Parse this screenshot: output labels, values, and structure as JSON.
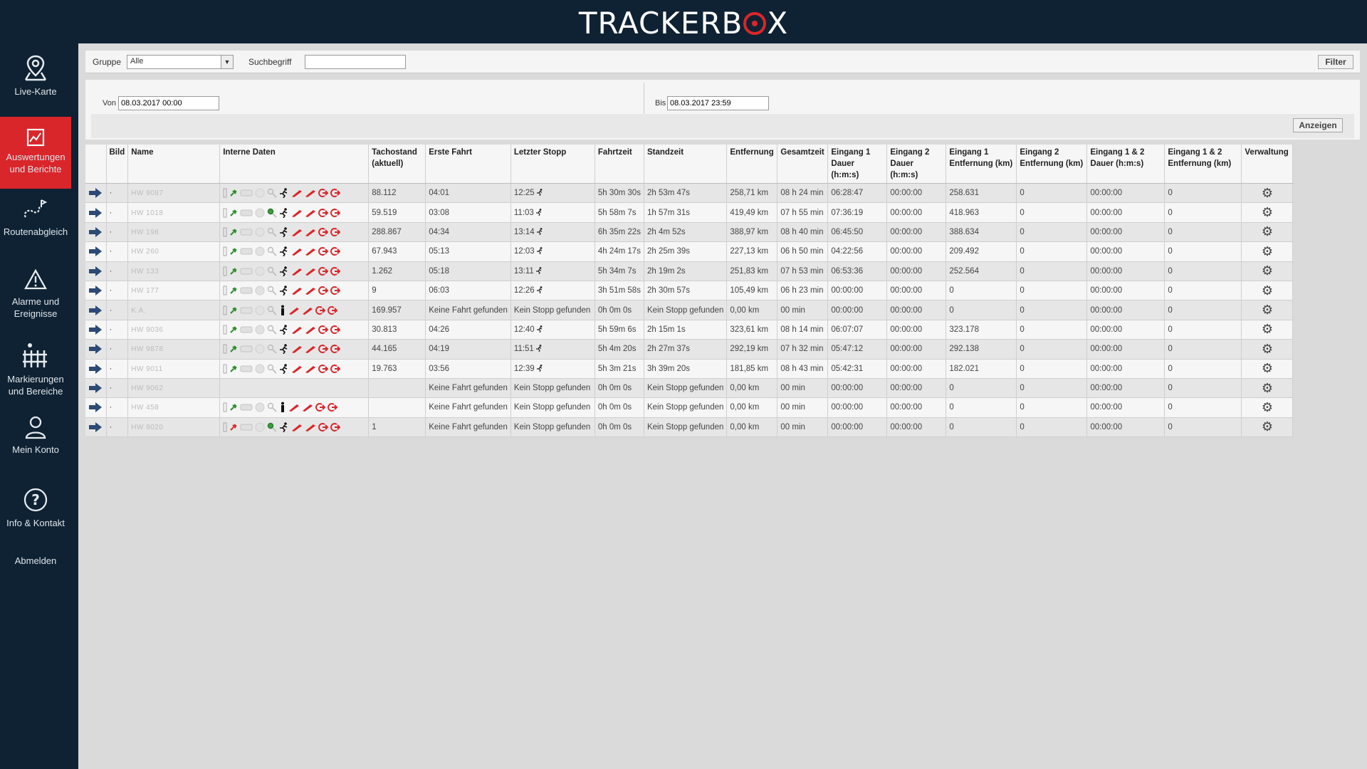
{
  "app": {
    "logo_text": "TRACKERB",
    "logo_end": "X"
  },
  "sidebar": {
    "items": [
      {
        "label": "Live-Karte",
        "icon": "map-pin-icon",
        "active": false
      },
      {
        "label": "Auswertungen und Berichte",
        "icon": "chart-icon",
        "active": true
      },
      {
        "label": "Routenabgleich",
        "icon": "route-icon",
        "active": false
      },
      {
        "label": "Alarme und Ereignisse",
        "icon": "warning-icon",
        "active": false
      },
      {
        "label": "Markierungen und Bereiche",
        "icon": "fence-icon",
        "active": false
      },
      {
        "label": "Mein Konto",
        "icon": "user-icon",
        "active": false
      },
      {
        "label": "Info & Kontakt",
        "icon": "question-icon",
        "active": false
      },
      {
        "label": "Abmelden",
        "icon": "",
        "active": false
      }
    ]
  },
  "filter": {
    "group_label": "Gruppe",
    "group_value": "Alle",
    "search_label": "Suchbegriff",
    "search_value": "",
    "filter_button": "Filter"
  },
  "dates": {
    "from_label": "Von",
    "from_value": "08.03.2017 00:00",
    "to_label": "Bis",
    "to_value": "08.03.2017 23:59",
    "show_button": "Anzeigen"
  },
  "table": {
    "headers": [
      "",
      "Bild",
      "Name",
      "Interne Daten",
      "Tachostand (aktuell)",
      "Erste Fahrt",
      "Letzter Stopp",
      "Fahrtzeit",
      "Standzeit",
      "Entfernung",
      "Gesamtzeit",
      "Eingang 1 Dauer (h:m:s)",
      "Eingang 2 Dauer (h:m:s)",
      "Eingang 1 Entfernung (km)",
      "Eingang 2 Entfernung (km)",
      "Eingang 1 & 2 Dauer (h:m:s)",
      "Eingang 1 & 2 Entfernung (km)",
      "Verwaltung"
    ],
    "rows": [
      {
        "bild": "·",
        "name": "HW 9087",
        "person": false,
        "green_search": false,
        "red_plug": false,
        "tacho": "88.112",
        "erste": "04:01",
        "letzter": "12:25",
        "stop_icon": true,
        "fahrt": "5h 30m 30s",
        "stand": "2h 53m 47s",
        "entf": "258,71 km",
        "gesamt": "08 h 24 min",
        "e1d": "06:28:47",
        "e2d": "00:00:00",
        "e1e": "258.631",
        "e2e": "0",
        "e12d": "00:00:00",
        "e12e": "0"
      },
      {
        "bild": "·",
        "name": "HW 1018",
        "person": false,
        "green_search": true,
        "red_plug": false,
        "tacho": "59.519",
        "erste": "03:08",
        "letzter": "11:03",
        "stop_icon": true,
        "fahrt": "5h 58m 7s",
        "stand": "1h 57m 31s",
        "entf": "419,49 km",
        "gesamt": "07 h 55 min",
        "e1d": "07:36:19",
        "e2d": "00:00:00",
        "e1e": "418.963",
        "e2e": "0",
        "e12d": "00:00:00",
        "e12e": "0"
      },
      {
        "bild": "·",
        "name": "HW 198",
        "person": false,
        "green_search": false,
        "red_plug": false,
        "tacho": "288.867",
        "erste": "04:34",
        "letzter": "13:14",
        "stop_icon": true,
        "fahrt": "6h 35m 22s",
        "stand": "2h 4m 52s",
        "entf": "388,97 km",
        "gesamt": "08 h 40 min",
        "e1d": "06:45:50",
        "e2d": "00:00:00",
        "e1e": "388.634",
        "e2e": "0",
        "e12d": "00:00:00",
        "e12e": "0"
      },
      {
        "bild": "·",
        "name": "HW 260",
        "person": false,
        "green_search": false,
        "red_plug": false,
        "tacho": "67.943",
        "erste": "05:13",
        "letzter": "12:03",
        "stop_icon": true,
        "fahrt": "4h 24m 17s",
        "stand": "2h 25m 39s",
        "entf": "227,13 km",
        "gesamt": "06 h 50 min",
        "e1d": "04:22:56",
        "e2d": "00:00:00",
        "e1e": "209.492",
        "e2e": "0",
        "e12d": "00:00:00",
        "e12e": "0"
      },
      {
        "bild": "·",
        "name": "HW 133",
        "person": false,
        "green_search": false,
        "red_plug": false,
        "tacho": "1.262",
        "erste": "05:18",
        "letzter": "13:11",
        "stop_icon": true,
        "fahrt": "5h 34m 7s",
        "stand": "2h 19m 2s",
        "entf": "251,83 km",
        "gesamt": "07 h 53 min",
        "e1d": "06:53:36",
        "e2d": "00:00:00",
        "e1e": "252.564",
        "e2e": "0",
        "e12d": "00:00:00",
        "e12e": "0"
      },
      {
        "bild": "·",
        "name": "HW 177",
        "person": false,
        "green_search": false,
        "red_plug": false,
        "tacho": "9",
        "erste": "06:03",
        "letzter": "12:26",
        "stop_icon": true,
        "fahrt": "3h 51m 58s",
        "stand": "2h 30m 57s",
        "entf": "105,49 km",
        "gesamt": "06 h 23 min",
        "e1d": "00:00:00",
        "e2d": "00:00:00",
        "e1e": "0",
        "e2e": "0",
        "e12d": "00:00:00",
        "e12e": "0"
      },
      {
        "bild": "·",
        "name": "K.A.",
        "person": true,
        "green_search": false,
        "red_plug": false,
        "tacho": "169.957",
        "erste": "Keine Fahrt gefunden",
        "letzter": "Kein Stopp gefunden",
        "stop_icon": false,
        "fahrt": "0h 0m 0s",
        "stand": "Kein Stopp gefunden",
        "entf": "0,00 km",
        "gesamt": "00 min",
        "e1d": "00:00:00",
        "e2d": "00:00:00",
        "e1e": "0",
        "e2e": "0",
        "e12d": "00:00:00",
        "e12e": "0"
      },
      {
        "bild": "·",
        "name": "HW 9036",
        "person": false,
        "green_search": false,
        "red_plug": false,
        "tacho": "30.813",
        "erste": "04:26",
        "letzter": "12:40",
        "stop_icon": true,
        "fahrt": "5h 59m 6s",
        "stand": "2h 15m 1s",
        "entf": "323,61 km",
        "gesamt": "08 h 14 min",
        "e1d": "06:07:07",
        "e2d": "00:00:00",
        "e1e": "323.178",
        "e2e": "0",
        "e12d": "00:00:00",
        "e12e": "0"
      },
      {
        "bild": "·",
        "name": "HW 9878",
        "person": false,
        "green_search": false,
        "red_plug": false,
        "tacho": "44.165",
        "erste": "04:19",
        "letzter": "11:51",
        "stop_icon": true,
        "fahrt": "5h 4m 20s",
        "stand": "2h 27m 37s",
        "entf": "292,19 km",
        "gesamt": "07 h 32 min",
        "e1d": "05:47:12",
        "e2d": "00:00:00",
        "e1e": "292.138",
        "e2e": "0",
        "e12d": "00:00:00",
        "e12e": "0"
      },
      {
        "bild": "·",
        "name": "HW 9011",
        "person": false,
        "green_search": false,
        "red_plug": false,
        "tacho": "19.763",
        "erste": "03:56",
        "letzter": "12:39",
        "stop_icon": true,
        "fahrt": "5h 3m 21s",
        "stand": "3h 39m 20s",
        "entf": "181,85 km",
        "gesamt": "08 h 43 min",
        "e1d": "05:42:31",
        "e2d": "00:00:00",
        "e1e": "182.021",
        "e2e": "0",
        "e12d": "00:00:00",
        "e12e": "0"
      },
      {
        "bild": "·",
        "name": "HW 9062",
        "person": false,
        "green_search": false,
        "red_plug": false,
        "empty_icons": true,
        "tacho": "",
        "erste": "Keine Fahrt gefunden",
        "letzter": "Kein Stopp gefunden",
        "stop_icon": false,
        "fahrt": "0h 0m 0s",
        "stand": "Kein Stopp gefunden",
        "entf": "0,00 km",
        "gesamt": "00 min",
        "e1d": "00:00:00",
        "e2d": "00:00:00",
        "e1e": "0",
        "e2e": "0",
        "e12d": "00:00:00",
        "e12e": "0"
      },
      {
        "bild": "·",
        "name": "HW 458",
        "person": true,
        "green_search": false,
        "red_plug": false,
        "tacho": "",
        "erste": "Keine Fahrt gefunden",
        "letzter": "Kein Stopp gefunden",
        "stop_icon": false,
        "fahrt": "0h 0m 0s",
        "stand": "Kein Stopp gefunden",
        "entf": "0,00 km",
        "gesamt": "00 min",
        "e1d": "00:00:00",
        "e2d": "00:00:00",
        "e1e": "0",
        "e2e": "0",
        "e12d": "00:00:00",
        "e12e": "0"
      },
      {
        "bild": "·",
        "name": "HW 9020",
        "person": false,
        "green_search": true,
        "red_plug": true,
        "tacho": "1",
        "erste": "Keine Fahrt gefunden",
        "letzter": "Kein Stopp gefunden",
        "stop_icon": false,
        "fahrt": "0h 0m 0s",
        "stand": "Kein Stopp gefunden",
        "entf": "0,00 km",
        "gesamt": "00 min",
        "e1d": "00:00:00",
        "e2d": "00:00:00",
        "e1e": "0",
        "e2e": "0",
        "e12d": "00:00:00",
        "e12e": "0"
      }
    ]
  },
  "colors": {
    "sidebar": "#0f2233",
    "accent": "#d9262b",
    "arrow": "#2c4a73"
  }
}
